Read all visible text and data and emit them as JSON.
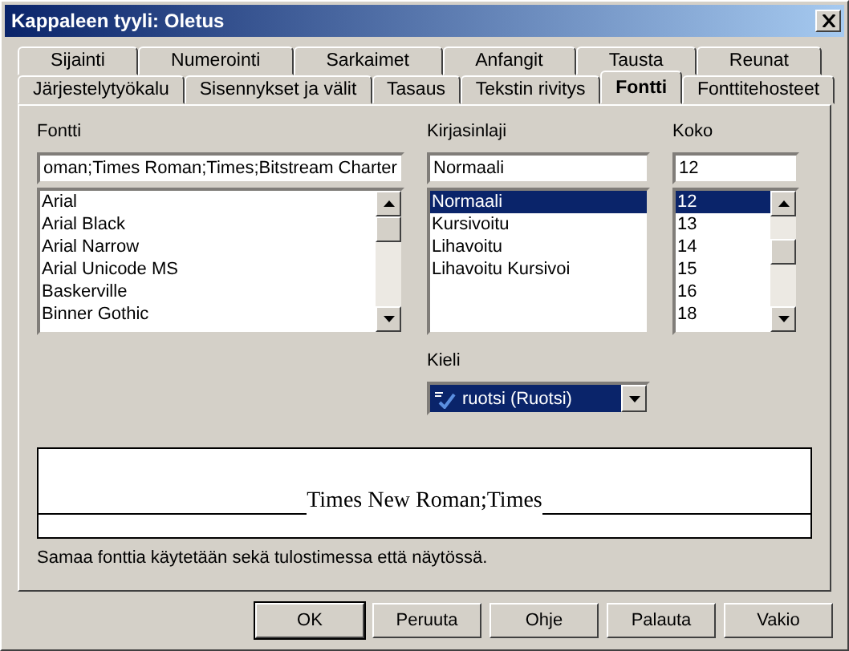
{
  "window": {
    "title": "Kappaleen tyyli: Oletus"
  },
  "tab_rows": [
    [
      {
        "label": "Sijainti",
        "selected": false
      },
      {
        "label": "Numerointi",
        "selected": false
      },
      {
        "label": "Sarkaimet",
        "selected": false
      },
      {
        "label": "Anfangit",
        "selected": false
      },
      {
        "label": "Tausta",
        "selected": false
      },
      {
        "label": "Reunat",
        "selected": false
      }
    ],
    [
      {
        "label": "Järjestelytyökalu",
        "selected": false
      },
      {
        "label": "Sisennykset ja välit",
        "selected": false
      },
      {
        "label": "Tasaus",
        "selected": false
      },
      {
        "label": "Tekstin rivitys",
        "selected": false
      },
      {
        "label": "Fontti",
        "selected": true
      },
      {
        "label": "Fonttitehosteet",
        "selected": false
      }
    ]
  ],
  "font": {
    "label": "Fontti",
    "value": "oman;Times Roman;Times;Bitstream Charter",
    "items": [
      {
        "label": "Arial",
        "selected": false
      },
      {
        "label": "Arial Black",
        "selected": false
      },
      {
        "label": "Arial Narrow",
        "selected": false
      },
      {
        "label": "Arial Unicode MS",
        "selected": false
      },
      {
        "label": "Baskerville",
        "selected": false
      },
      {
        "label": "Binner Gothic",
        "selected": false
      }
    ]
  },
  "style": {
    "label": "Kirjasinlaji",
    "value": "Normaali",
    "items": [
      {
        "label": "Normaali",
        "selected": true
      },
      {
        "label": "Kursivoitu",
        "selected": false
      },
      {
        "label": "Lihavoitu",
        "selected": false
      },
      {
        "label": "Lihavoitu Kursivoi",
        "selected": false
      }
    ]
  },
  "size": {
    "label": "Koko",
    "value": "12",
    "items": [
      {
        "label": "12",
        "selected": true
      },
      {
        "label": "13",
        "selected": false
      },
      {
        "label": "14",
        "selected": false
      },
      {
        "label": "15",
        "selected": false
      },
      {
        "label": "16",
        "selected": false
      },
      {
        "label": "18",
        "selected": false
      }
    ]
  },
  "language": {
    "label": "Kieli",
    "value": "ruotsi (Ruotsi)"
  },
  "preview": {
    "text": "Times New Roman;Times"
  },
  "note": "Samaa fonttia käytetään sekä tulostimessa että näytössä.",
  "buttons": [
    {
      "label": "OK",
      "default": true
    },
    {
      "label": "Peruuta",
      "default": false
    },
    {
      "label": "Ohje",
      "default": false
    },
    {
      "label": "Palauta",
      "default": false
    },
    {
      "label": "Vakio",
      "default": false
    }
  ]
}
